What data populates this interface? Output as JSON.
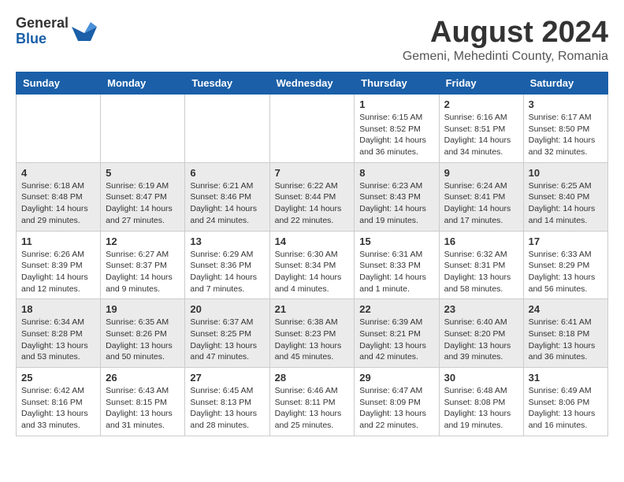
{
  "header": {
    "logo_general": "General",
    "logo_blue": "Blue",
    "month_title": "August 2024",
    "location": "Gemeni, Mehedinti County, Romania"
  },
  "weekdays": [
    "Sunday",
    "Monday",
    "Tuesday",
    "Wednesday",
    "Thursday",
    "Friday",
    "Saturday"
  ],
  "weeks": [
    [
      {
        "day": "",
        "info": ""
      },
      {
        "day": "",
        "info": ""
      },
      {
        "day": "",
        "info": ""
      },
      {
        "day": "",
        "info": ""
      },
      {
        "day": "1",
        "info": "Sunrise: 6:15 AM\nSunset: 8:52 PM\nDaylight: 14 hours\nand 36 minutes."
      },
      {
        "day": "2",
        "info": "Sunrise: 6:16 AM\nSunset: 8:51 PM\nDaylight: 14 hours\nand 34 minutes."
      },
      {
        "day": "3",
        "info": "Sunrise: 6:17 AM\nSunset: 8:50 PM\nDaylight: 14 hours\nand 32 minutes."
      }
    ],
    [
      {
        "day": "4",
        "info": "Sunrise: 6:18 AM\nSunset: 8:48 PM\nDaylight: 14 hours\nand 29 minutes."
      },
      {
        "day": "5",
        "info": "Sunrise: 6:19 AM\nSunset: 8:47 PM\nDaylight: 14 hours\nand 27 minutes."
      },
      {
        "day": "6",
        "info": "Sunrise: 6:21 AM\nSunset: 8:46 PM\nDaylight: 14 hours\nand 24 minutes."
      },
      {
        "day": "7",
        "info": "Sunrise: 6:22 AM\nSunset: 8:44 PM\nDaylight: 14 hours\nand 22 minutes."
      },
      {
        "day": "8",
        "info": "Sunrise: 6:23 AM\nSunset: 8:43 PM\nDaylight: 14 hours\nand 19 minutes."
      },
      {
        "day": "9",
        "info": "Sunrise: 6:24 AM\nSunset: 8:41 PM\nDaylight: 14 hours\nand 17 minutes."
      },
      {
        "day": "10",
        "info": "Sunrise: 6:25 AM\nSunset: 8:40 PM\nDaylight: 14 hours\nand 14 minutes."
      }
    ],
    [
      {
        "day": "11",
        "info": "Sunrise: 6:26 AM\nSunset: 8:39 PM\nDaylight: 14 hours\nand 12 minutes."
      },
      {
        "day": "12",
        "info": "Sunrise: 6:27 AM\nSunset: 8:37 PM\nDaylight: 14 hours\nand 9 minutes."
      },
      {
        "day": "13",
        "info": "Sunrise: 6:29 AM\nSunset: 8:36 PM\nDaylight: 14 hours\nand 7 minutes."
      },
      {
        "day": "14",
        "info": "Sunrise: 6:30 AM\nSunset: 8:34 PM\nDaylight: 14 hours\nand 4 minutes."
      },
      {
        "day": "15",
        "info": "Sunrise: 6:31 AM\nSunset: 8:33 PM\nDaylight: 14 hours\nand 1 minute."
      },
      {
        "day": "16",
        "info": "Sunrise: 6:32 AM\nSunset: 8:31 PM\nDaylight: 13 hours\nand 58 minutes."
      },
      {
        "day": "17",
        "info": "Sunrise: 6:33 AM\nSunset: 8:29 PM\nDaylight: 13 hours\nand 56 minutes."
      }
    ],
    [
      {
        "day": "18",
        "info": "Sunrise: 6:34 AM\nSunset: 8:28 PM\nDaylight: 13 hours\nand 53 minutes."
      },
      {
        "day": "19",
        "info": "Sunrise: 6:35 AM\nSunset: 8:26 PM\nDaylight: 13 hours\nand 50 minutes."
      },
      {
        "day": "20",
        "info": "Sunrise: 6:37 AM\nSunset: 8:25 PM\nDaylight: 13 hours\nand 47 minutes."
      },
      {
        "day": "21",
        "info": "Sunrise: 6:38 AM\nSunset: 8:23 PM\nDaylight: 13 hours\nand 45 minutes."
      },
      {
        "day": "22",
        "info": "Sunrise: 6:39 AM\nSunset: 8:21 PM\nDaylight: 13 hours\nand 42 minutes."
      },
      {
        "day": "23",
        "info": "Sunrise: 6:40 AM\nSunset: 8:20 PM\nDaylight: 13 hours\nand 39 minutes."
      },
      {
        "day": "24",
        "info": "Sunrise: 6:41 AM\nSunset: 8:18 PM\nDaylight: 13 hours\nand 36 minutes."
      }
    ],
    [
      {
        "day": "25",
        "info": "Sunrise: 6:42 AM\nSunset: 8:16 PM\nDaylight: 13 hours\nand 33 minutes."
      },
      {
        "day": "26",
        "info": "Sunrise: 6:43 AM\nSunset: 8:15 PM\nDaylight: 13 hours\nand 31 minutes."
      },
      {
        "day": "27",
        "info": "Sunrise: 6:45 AM\nSunset: 8:13 PM\nDaylight: 13 hours\nand 28 minutes."
      },
      {
        "day": "28",
        "info": "Sunrise: 6:46 AM\nSunset: 8:11 PM\nDaylight: 13 hours\nand 25 minutes."
      },
      {
        "day": "29",
        "info": "Sunrise: 6:47 AM\nSunset: 8:09 PM\nDaylight: 13 hours\nand 22 minutes."
      },
      {
        "day": "30",
        "info": "Sunrise: 6:48 AM\nSunset: 8:08 PM\nDaylight: 13 hours\nand 19 minutes."
      },
      {
        "day": "31",
        "info": "Sunrise: 6:49 AM\nSunset: 8:06 PM\nDaylight: 13 hours\nand 16 minutes."
      }
    ]
  ]
}
